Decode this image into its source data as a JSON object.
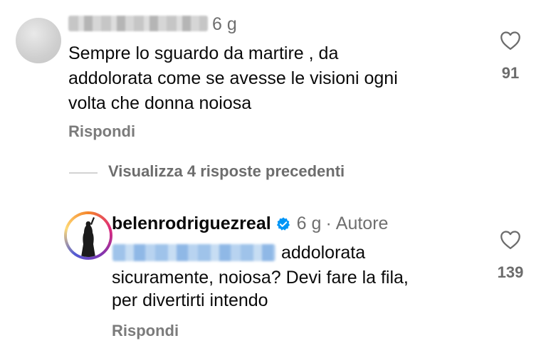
{
  "comment1": {
    "time": "6 g",
    "text_lines": [
      "Sempre lo sguardo da martire , da",
      "addolorata come se avesse le visioni ogni",
      "volta che donna noiosa"
    ],
    "like_count": "91",
    "reply_label": "Rispondi"
  },
  "view_replies": {
    "label": "Visualizza 4 risposte precedenti"
  },
  "comment2": {
    "username": "belenrodriguezreal",
    "time": "6 g",
    "separator": "·",
    "author_badge": "Autore",
    "text_lines": [
      "addolorata",
      "sicuramente, noiosa? Devi fare la fila,",
      "per divertirti intendo"
    ],
    "like_count": "139",
    "reply_label": "Rispondi"
  },
  "icons": {
    "heart": "heart-outline-icon",
    "verified": "verified-badge-icon",
    "verified_color": "#0095f6"
  }
}
